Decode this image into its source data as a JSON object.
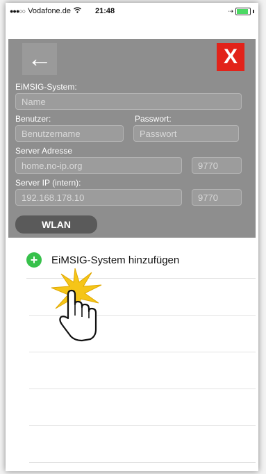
{
  "statusbar": {
    "carrier": "Vodafone.de",
    "time": "21:48",
    "signal": "●●●○○"
  },
  "toolbar": {
    "back_label": "←",
    "close_label": "X"
  },
  "form": {
    "system_label": "EiMSIG-System:",
    "name_placeholder": "Name",
    "user_label": "Benutzer:",
    "password_label": "Passwort:",
    "username_placeholder": "Benutzername",
    "password_placeholder": "Passwort",
    "server_label": "Server Adresse",
    "server_address": "home.no-ip.org",
    "server_port": "9770",
    "server_ip_label": "Server IP (intern):",
    "server_ip": "192.168.178.10",
    "server_ip_port": "9770",
    "wlan_label": "WLAN"
  },
  "list": {
    "add_label": "EiMSIG-System hinzufügen"
  },
  "colors": {
    "form_bg": "#8e8e8e",
    "close_red": "#e2231a",
    "add_green": "#37c14b",
    "wlan_bg": "#5a5a5a"
  }
}
